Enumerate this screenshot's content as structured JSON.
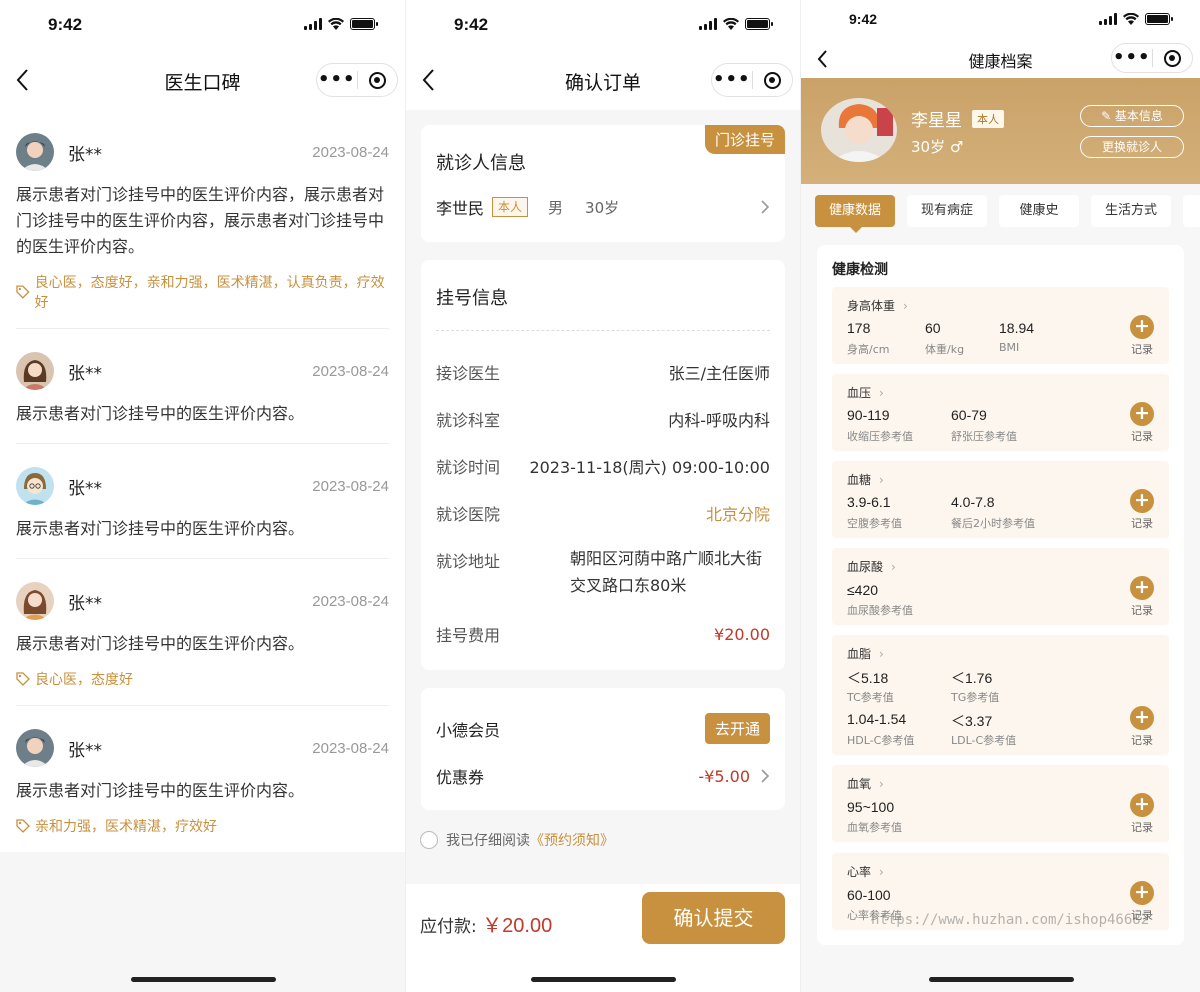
{
  "status": {
    "time": "9:42"
  },
  "p1": {
    "title": "医生口碑",
    "reviews": [
      {
        "name": "张**",
        "date": "2023-08-24",
        "text": "展示患者对门诊挂号中的医生评价内容，展示患者对门诊挂号中的医生评价内容，展示患者对门诊挂号中的医生评价内容。",
        "tags": "良心医，态度好，亲和力强，医术精湛，认真负责，疗效好"
      },
      {
        "name": "张**",
        "date": "2023-08-24",
        "text": "展示患者对门诊挂号中的医生评价内容。",
        "tags": ""
      },
      {
        "name": "张**",
        "date": "2023-08-24",
        "text": "展示患者对门诊挂号中的医生评价内容。",
        "tags": ""
      },
      {
        "name": "张**",
        "date": "2023-08-24",
        "text": "展示患者对门诊挂号中的医生评价内容。",
        "tags": "良心医，态度好"
      },
      {
        "name": "张**",
        "date": "2023-08-24",
        "text": "展示患者对门诊挂号中的医生评价内容。",
        "tags": "亲和力强，医术精湛，疗效好"
      }
    ]
  },
  "p2": {
    "title": "确认订单",
    "badge": "门诊挂号",
    "patient_title": "就诊人信息",
    "patient_name": "李世民",
    "patient_tag": "本人",
    "patient_gender": "男",
    "patient_age": "30岁",
    "reg_title": "挂号信息",
    "rows": [
      {
        "label": "接诊医生",
        "value": "张三/主任医师"
      },
      {
        "label": "就诊科室",
        "value": "内科-呼吸内科"
      },
      {
        "label": "就诊时间",
        "value": "2023-11-18(周六) 09:00-10:00"
      },
      {
        "label": "就诊医院",
        "value": "北京分院"
      },
      {
        "label": "就诊地址",
        "value": "朝阳区河荫中路广顺北大街交叉路口东80米"
      },
      {
        "label": "挂号费用",
        "value": "¥20.00"
      }
    ],
    "member_label": "小德会员",
    "member_btn": "去开通",
    "coupon_label": "优惠券",
    "coupon_value": "-¥5.00",
    "agree_text": "我已仔细阅读",
    "agree_link": "《预约须知》",
    "pay_label": "应付款:",
    "pay_amount": "￥20.00",
    "submit": "确认提交"
  },
  "p3": {
    "title": "健康档案",
    "name": "李星星",
    "me_tag": "本人",
    "age": "30岁 ♂",
    "btn_info": "✎ 基本信息",
    "btn_switch": "更换就诊人",
    "tabs": [
      "健康数据",
      "现有病症",
      "健康史",
      "生活方式"
    ],
    "section": "健康检测",
    "record_label": "记录",
    "metrics": [
      {
        "name": "身高体重",
        "vals": [
          {
            "v": "178",
            "s": "身高/cm"
          },
          {
            "v": "60",
            "s": "体重/kg"
          },
          {
            "v": "18.94",
            "s": "BMI"
          }
        ]
      },
      {
        "name": "血压",
        "vals": [
          {
            "v": "90-119",
            "s": "收缩压参考值"
          },
          {
            "v": "60-79",
            "s": "舒张压参考值"
          }
        ]
      },
      {
        "name": "血糖",
        "vals": [
          {
            "v": "3.9-6.1",
            "s": "空腹参考值"
          },
          {
            "v": "4.0-7.8",
            "s": "餐后2小时参考值"
          }
        ]
      },
      {
        "name": "血尿酸",
        "vals": [
          {
            "v": "≤420",
            "s": "血尿酸参考值"
          }
        ]
      },
      {
        "name": "血脂",
        "vals": [
          {
            "v": "＜5.18",
            "s": "TC参考值"
          },
          {
            "v": "＜1.76",
            "s": "TG参考值"
          },
          {
            "v": "1.04-1.54",
            "s": "HDL-C参考值"
          },
          {
            "v": "＜3.37",
            "s": "LDL-C参考值"
          }
        ]
      },
      {
        "name": "血氧",
        "vals": [
          {
            "v": "95~100",
            "s": "血氧参考值"
          }
        ]
      },
      {
        "name": "心率",
        "vals": [
          {
            "v": "60-100",
            "s": "心率参考值"
          }
        ]
      }
    ],
    "watermark": "https://www.huzhan.com/ishop46682"
  },
  "colors": {
    "accent": "#c8913f",
    "price": "#c0392b"
  }
}
